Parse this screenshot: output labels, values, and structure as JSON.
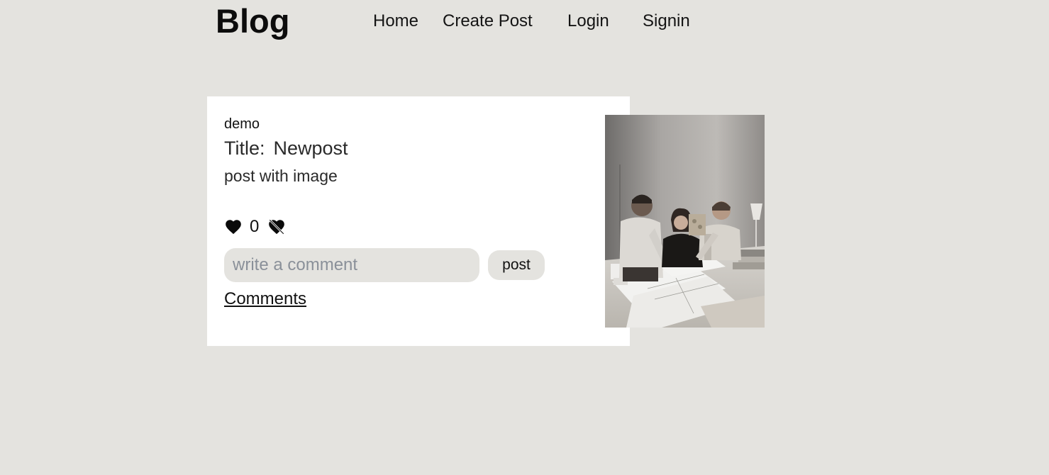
{
  "header": {
    "brand": "Blog",
    "nav": {
      "home": "Home",
      "create_post": "Create Post",
      "login": "Login",
      "signin": "Signin"
    }
  },
  "post": {
    "author": "demo",
    "title_label": "Title:",
    "title": "Newpost",
    "body": "post with image",
    "likes": "0",
    "comment_placeholder": "write a comment",
    "post_button": "post",
    "comments_link": "Comments",
    "image": {
      "description_icon": "photo-of-three-people-reviewing-blueprints"
    }
  },
  "colors": {
    "page_background": "#e4e3df",
    "card_background": "#ffffff",
    "input_background": "#e4e3df",
    "text": "#111111"
  }
}
